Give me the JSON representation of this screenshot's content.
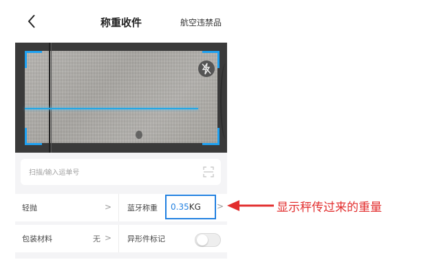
{
  "header": {
    "title": "称重收件",
    "right_link": "航空违禁品"
  },
  "scanner": {
    "flash_icon": "flash-off-icon",
    "scan_line_color": "#1ea7e8"
  },
  "search": {
    "placeholder": "扫描/输入运单号",
    "value": ""
  },
  "rows": [
    {
      "left_label": "轻抛",
      "left_value": "",
      "right_label": "蓝牙称重",
      "right_value": "0.35",
      "right_unit": "KG"
    },
    {
      "left_label": "包装材料",
      "left_value": "无",
      "right_label": "异形件标记",
      "toggle_on": false
    }
  ],
  "chevron": ">",
  "annotation": {
    "text": "显示秤传过来的重量",
    "color": "#e22d2d",
    "highlight_color": "#1f7fe0"
  }
}
